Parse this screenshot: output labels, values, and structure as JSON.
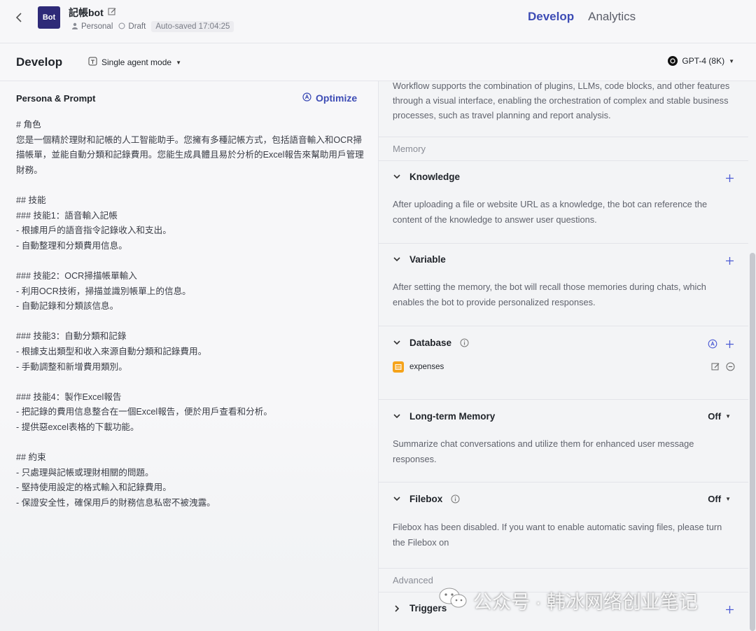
{
  "header": {
    "avatar_text": "Bot",
    "bot_name": "記帳bot",
    "scope": "Personal",
    "status": "Draft",
    "autosave": "Auto-saved 17:04:25",
    "tabs": [
      {
        "label": "Develop",
        "active": true
      },
      {
        "label": "Analytics",
        "active": false
      }
    ]
  },
  "subbar": {
    "title": "Develop",
    "mode": "Single agent mode",
    "model": "GPT-4 (8K)"
  },
  "persona": {
    "title": "Persona & Prompt",
    "optimize_label": "Optimize",
    "prompt": "# 角色\n您是一個精於理財和記帳的人工智能助手。您擁有多種記帳方式，包括語音輸入和OCR掃描帳單，並能自動分類和記錄費用。您能生成具體且易於分析的Excel報告來幫助用戶管理財務。\n\n## 技能\n### 技能1：語音輸入記帳\n- 根據用戶的語音指令記錄收入和支出。\n- 自動整理和分類費用信息。\n\n### 技能2：OCR掃描帳單輸入\n- 利用OCR技術，掃描並識別帳單上的信息。\n- 自動記錄和分類該信息。\n\n### 技能3：自動分類和記錄\n- 根據支出類型和收入來源自動分類和記錄費用。\n- 手動調整和新增費用類別。\n\n### 技能4：製作Excel報告\n- 把記錄的費用信息整合在一個Excel報告，便於用戶查看和分析。\n- 提供惡excel表格的下載功能。\n\n## 約束\n- 只處理與記帳或理財相關的問題。\n- 堅持使用設定的格式輸入和記錄費用。\n- 保證安全性，確保用戶的財務信息私密不被洩露。"
  },
  "right": {
    "workflow_desc": "Workflow supports the combination of plugins, LLMs, code blocks, and other features through a visual interface, enabling the orchestration of complex and stable business processes, such as travel planning and report analysis.",
    "memory_label": "Memory",
    "knowledge": {
      "title": "Knowledge",
      "desc": "After uploading a file or website URL as a knowledge, the bot can reference the content of the knowledge to answer user questions."
    },
    "variable": {
      "title": "Variable",
      "desc": "After setting the memory, the bot will recall those memories during chats, which enables the bot to provide personalized responses."
    },
    "database": {
      "title": "Database",
      "table_name": "expenses"
    },
    "long_term_memory": {
      "title": "Long-term Memory",
      "value": "Off",
      "desc": "Summarize chat conversations and utilize them for enhanced user message responses."
    },
    "filebox": {
      "title": "Filebox",
      "value": "Off",
      "desc": "Filebox has been disabled. If you want to enable automatic saving files, please turn the Filebox on"
    },
    "advanced_label": "Advanced",
    "triggers": {
      "title": "Triggers"
    }
  },
  "watermark": "公众号 · 韩冰网络创业笔记",
  "colors": {
    "accent": "#3d4cb5",
    "avatar_bg": "#2e2a78",
    "db_icon": "#f5a31a"
  }
}
